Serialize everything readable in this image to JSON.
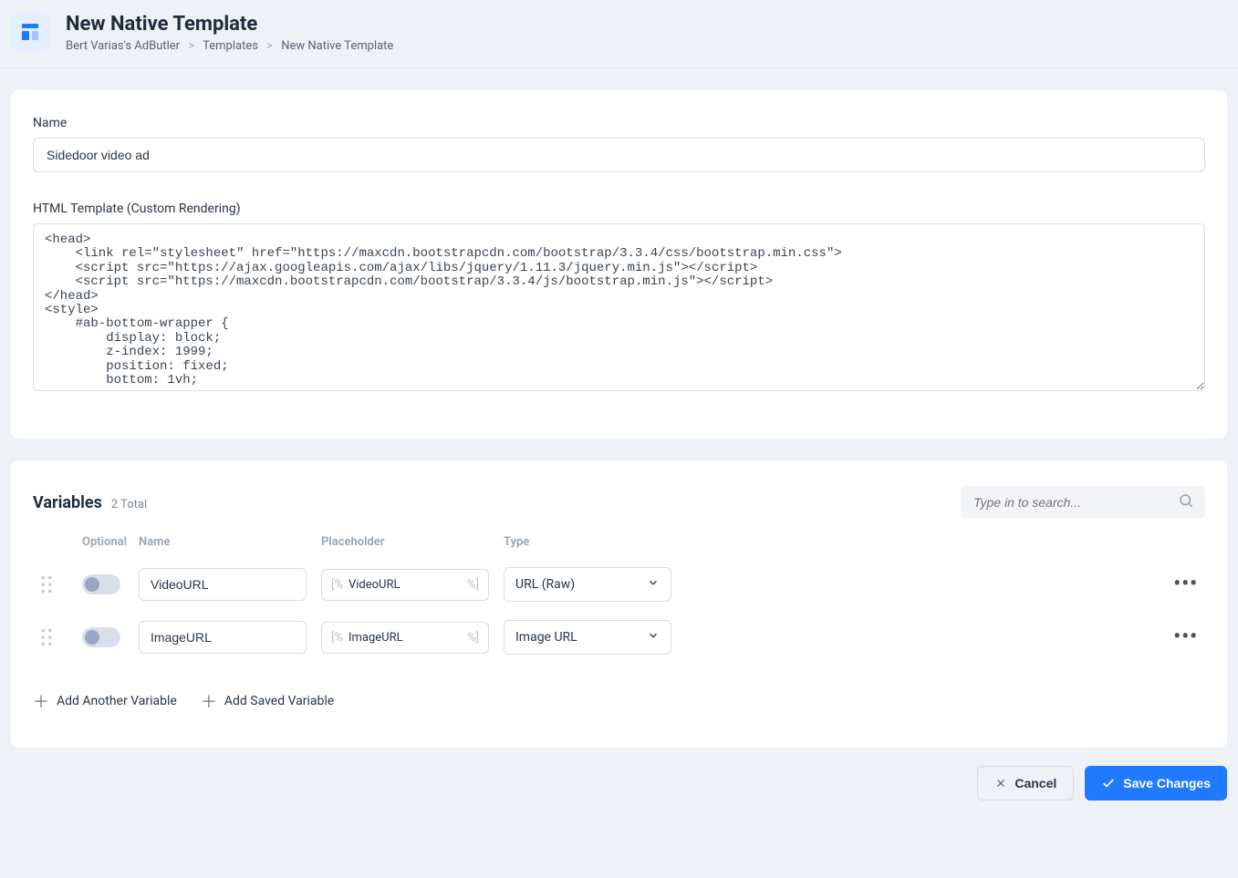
{
  "header": {
    "title": "New Native Template",
    "breadcrumbs": [
      "Bert Varias's AdButler",
      "Templates",
      "New Native Template"
    ]
  },
  "form": {
    "name_label": "Name",
    "name_value": "Sidedoor video ad",
    "html_label": "HTML Template (Custom Rendering)",
    "html_value": "<head>\n    <link rel=\"stylesheet\" href=\"https://maxcdn.bootstrapcdn.com/bootstrap/3.3.4/css/bootstrap.min.css\">\n    <script src=\"https://ajax.googleapis.com/ajax/libs/jquery/1.11.3/jquery.min.js\"></script>\n    <script src=\"https://maxcdn.bootstrapcdn.com/bootstrap/3.3.4/js/bootstrap.min.js\"></script>\n</head>\n<style>\n    #ab-bottom-wrapper {\n        display: block;\n        z-index: 1999;\n        position: fixed;\n        bottom: 1vh;"
  },
  "variables": {
    "title": "Variables",
    "count": "2 Total",
    "search_placeholder": "Type in to search...",
    "headers": {
      "optional": "Optional",
      "name": "Name",
      "placeholder": "Placeholder",
      "type": "Type"
    },
    "rows": [
      {
        "name": "VideoURL",
        "placeholder": "VideoURL",
        "type": "URL (Raw)"
      },
      {
        "name": "ImageURL",
        "placeholder": "ImageURL",
        "type": "Image URL"
      }
    ],
    "ph_open": "[%",
    "ph_close": "%]",
    "add_another": "Add Another Variable",
    "add_saved": "Add Saved Variable"
  },
  "footer": {
    "cancel": "Cancel",
    "save": "Save Changes"
  }
}
